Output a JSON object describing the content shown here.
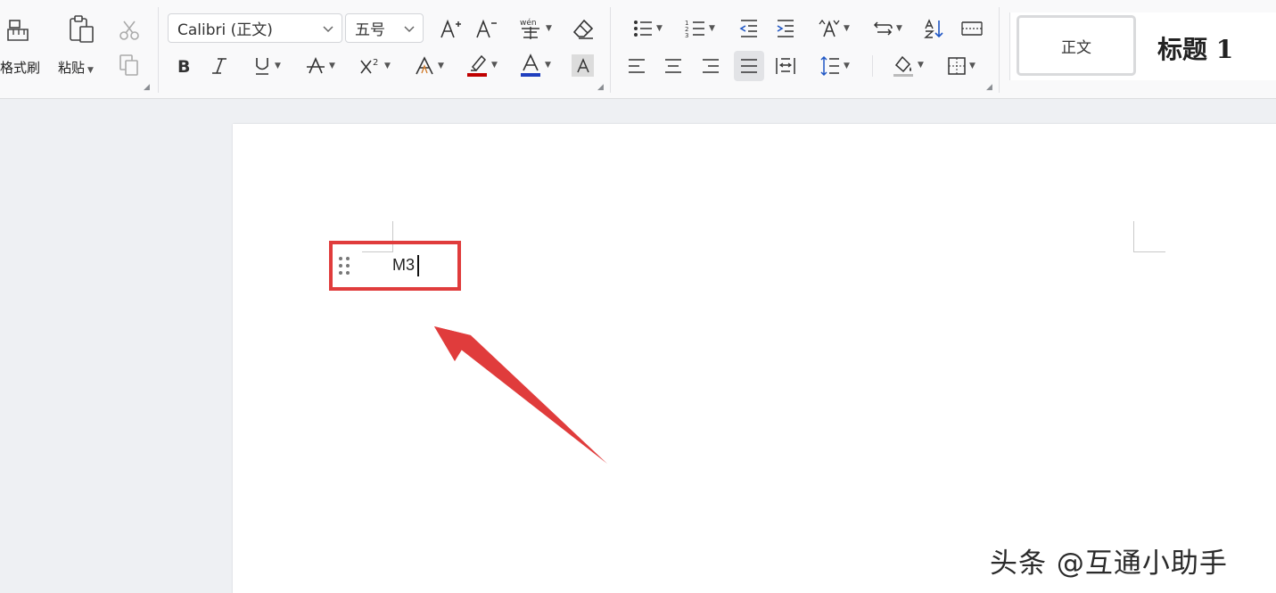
{
  "ribbon": {
    "clipboard": {
      "format_painter_label": "格式刷",
      "paste_label": "粘贴"
    },
    "font": {
      "font_name": "Calibri (正文)",
      "font_size": "五号"
    },
    "styles": {
      "normal_label": "正文",
      "heading1_label": "标题 1"
    }
  },
  "document": {
    "typed_text": "M3"
  },
  "watermark": "头条 @互通小助手",
  "colors": {
    "annotation_red": "#e03c3c",
    "font_color_red": "#c00000",
    "font_color_blue": "#1f3fbf"
  },
  "icons": [
    "format-painter-icon",
    "paste-icon",
    "cut-icon",
    "copy-icon",
    "increase-font-icon",
    "decrease-font-icon",
    "phonetic-guide-icon",
    "clear-format-icon",
    "bold-icon",
    "italic-icon",
    "underline-icon",
    "strikethrough-icon",
    "superscript-icon",
    "text-effect-icon",
    "highlight-icon",
    "font-color-icon",
    "char-shading-icon",
    "bullets-icon",
    "numbering-icon",
    "decrease-indent-icon",
    "increase-indent-icon",
    "chinese-layout-icon",
    "text-direction-icon",
    "sort-icon",
    "show-marks-icon",
    "align-left-icon",
    "align-center-icon",
    "align-right-icon",
    "justify-icon",
    "distributed-icon",
    "line-spacing-icon",
    "shading-icon",
    "borders-icon",
    "drag-handle-icon",
    "annotation-arrow-icon"
  ]
}
